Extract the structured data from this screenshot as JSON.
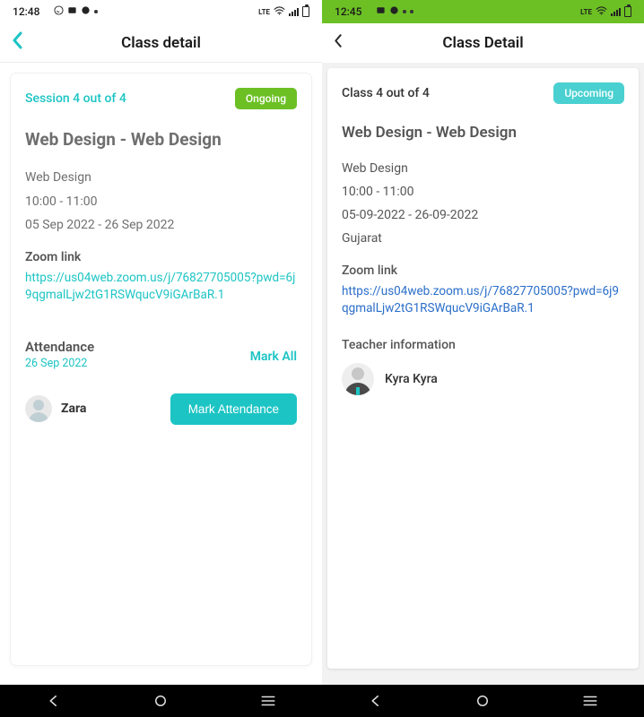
{
  "left": {
    "statusbar": {
      "time": "12:48"
    },
    "header": {
      "title": "Class detail"
    },
    "card": {
      "session": "Session 4 out of 4",
      "badge": "Ongoing",
      "course_title": "Web Design - Web Design",
      "subject": "Web Design",
      "time_range": "10:00 - 11:00",
      "date_range": "05 Sep 2022 - 26 Sep 2022",
      "zoom_label": "Zoom link",
      "zoom_url": "https://us04web.zoom.us/j/76827705005?pwd=6j9qgmalLjw2tG1RSWqucV9iGArBaR.1",
      "attendance": {
        "label": "Attendance",
        "date": "26 Sep 2022",
        "mark_all": "Mark All",
        "student_name": "Zara",
        "mark_btn": "Mark Attendance"
      }
    }
  },
  "right": {
    "statusbar": {
      "time": "12:45"
    },
    "header": {
      "title": "Class Detail"
    },
    "card": {
      "session": "Class 4 out of 4",
      "badge": "Upcoming",
      "course_title": "Web Design - Web Design",
      "subject": "Web Design",
      "time_range": "10:00 - 11:00",
      "date_range": "05-09-2022 - 26-09-2022",
      "location": "Gujarat",
      "zoom_label": "Zoom link",
      "zoom_url": "https://us04web.zoom.us/j/76827705005?pwd=6j9qgmalLjw2tG1RSWqucV9iGArBaR.1",
      "teacher": {
        "label": "Teacher information",
        "name": "Kyra Kyra"
      }
    }
  }
}
